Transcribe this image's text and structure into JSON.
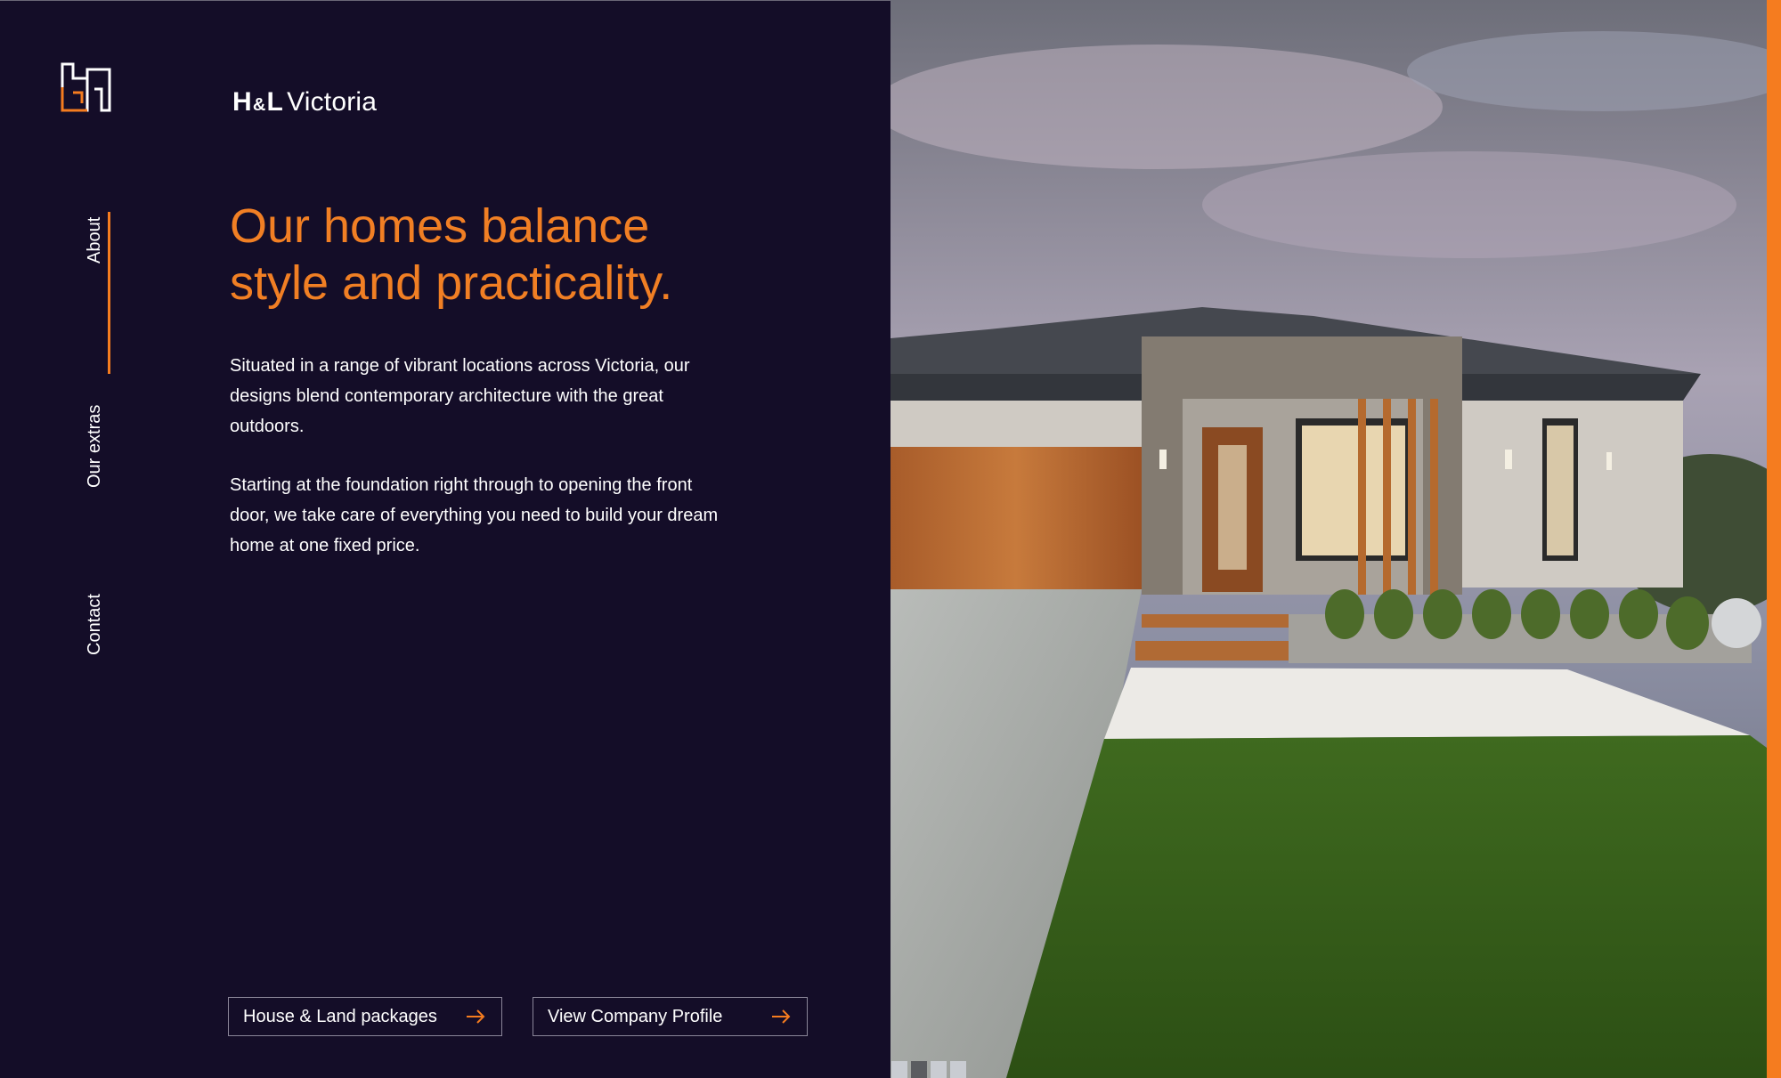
{
  "brand": {
    "mark_icon": "hl-building-logo-icon",
    "name_bold_1": "H",
    "name_amp": "&",
    "name_bold_2": "L",
    "name_region": "Victoria"
  },
  "nav": {
    "items": [
      {
        "label": "About",
        "active": true
      },
      {
        "label": "Our extras",
        "active": false
      },
      {
        "label": "Contact",
        "active": false
      }
    ]
  },
  "hero": {
    "headline": "Our homes balance style and practicality.",
    "paragraphs": [
      "Situated in a range of vibrant locations across Victoria, our designs blend contemporary architecture with the great outdoors.",
      "Starting at the foundation right through to opening the front door, we take care of everything you need to build your dream home at one fixed price."
    ]
  },
  "actions": {
    "packages_label": "House & Land packages",
    "profile_label": "View Company Profile",
    "arrow_icon": "arrow-right-icon"
  },
  "gallery": {
    "image_icon": "house-exterior-photo",
    "slide_count": 4,
    "active_slide": 2
  },
  "colors": {
    "background": "#140d28",
    "accent": "#f57c1f",
    "headline": "#f17f24",
    "text": "#ffffff"
  }
}
